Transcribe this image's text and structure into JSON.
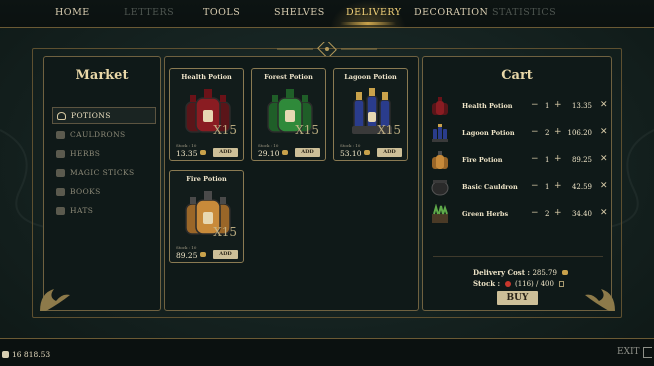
{
  "nav": {
    "tabs": [
      {
        "label": "HOME",
        "state": "normal"
      },
      {
        "label": "LETTERS",
        "state": "disabled"
      },
      {
        "label": "TOOLS",
        "state": "normal"
      },
      {
        "label": "SHELVES",
        "state": "normal"
      },
      {
        "label": "DELIVERY",
        "state": "active"
      },
      {
        "label": "DECORATION",
        "state": "normal"
      },
      {
        "label": "STATISTICS",
        "state": "disabled"
      }
    ]
  },
  "market": {
    "title": "Market",
    "categories": [
      {
        "label": "POTIONS",
        "active": true
      },
      {
        "label": "CAULDRONS",
        "active": false
      },
      {
        "label": "HERBS",
        "active": false
      },
      {
        "label": "MAGIC STICKS",
        "active": false
      },
      {
        "label": "BOOKS",
        "active": false
      },
      {
        "label": "HATS",
        "active": false
      }
    ]
  },
  "products": [
    {
      "name": "Health Potion",
      "qty": "X15",
      "stock": "Stock : 10",
      "price": "13.35",
      "add": "ADD",
      "liquid": "#8a1c22"
    },
    {
      "name": "Forest Potion",
      "qty": "X15",
      "stock": "Stock : 10",
      "price": "29.10",
      "add": "ADD",
      "liquid": "#2f8a3a"
    },
    {
      "name": "Lagoon Potion",
      "qty": "X15",
      "stock": "Stock : 10",
      "price": "53.10",
      "add": "ADD",
      "liquid": "#2a3c8c"
    },
    {
      "name": "Fire Potion",
      "qty": "X15",
      "stock": "Stock : 10",
      "price": "89.25",
      "add": "ADD",
      "liquid": "#c88a3a"
    }
  ],
  "cart": {
    "title": "Cart",
    "items": [
      {
        "name": "Health Potion",
        "qty": "1",
        "price": "13.35",
        "icon": "health-potion-icon"
      },
      {
        "name": "Lagoon Potion",
        "qty": "2",
        "price": "106.20",
        "icon": "lagoon-potion-icon"
      },
      {
        "name": "Fire Potion",
        "qty": "1",
        "price": "89.25",
        "icon": "fire-potion-icon"
      },
      {
        "name": "Basic Cauldron",
        "qty": "1",
        "price": "42.59",
        "icon": "cauldron-icon"
      },
      {
        "name": "Green Herbs",
        "qty": "2",
        "price": "34.40",
        "icon": "herbs-icon"
      }
    ],
    "minus": "−",
    "plus": "+",
    "remove": "✕",
    "delivery_cost_label": "Delivery Cost :",
    "delivery_cost_value": "285.79",
    "stock_label": "Stock :",
    "stock_value": "(116) / 400",
    "buy_label": "BUY"
  },
  "footer": {
    "money": "16 818.53",
    "exit_label": "EXIT"
  },
  "colors": {
    "accent": "#c9a24b",
    "button": "#cdbf98",
    "panel_border": "#6f6140"
  }
}
